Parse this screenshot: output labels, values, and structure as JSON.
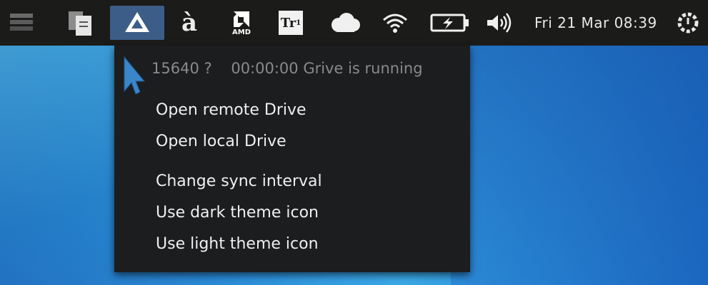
{
  "topbar": {
    "indicators": [
      {
        "name": "drawer-icon"
      },
      {
        "name": "clipboard-icon"
      },
      {
        "name": "google-drive-icon",
        "active": true
      },
      {
        "name": "amazon-icon",
        "glyph": "à"
      },
      {
        "name": "amd-icon",
        "label": "AMD"
      },
      {
        "name": "translator-icon",
        "label": "Tr",
        "sub": "1"
      },
      {
        "name": "cloud-icon"
      },
      {
        "name": "wifi-icon"
      },
      {
        "name": "battery-icon"
      },
      {
        "name": "volume-icon"
      },
      {
        "name": "power-gear-icon"
      }
    ],
    "clock": "Fri 21 Mar  08:39"
  },
  "menu": {
    "status": "15640 ?    00:00:00 Grive is running",
    "items": [
      {
        "label": "Open remote Drive"
      },
      {
        "label": "Open local Drive"
      },
      {
        "label": "Change sync interval"
      },
      {
        "label": "Use dark theme icon"
      },
      {
        "label": "Use light theme icon"
      }
    ]
  },
  "colors": {
    "panel": "#1b1b1a",
    "menu": "#1c1d1f",
    "active_indicator": "#3c5d87",
    "desktop": "#2a8ad6"
  }
}
